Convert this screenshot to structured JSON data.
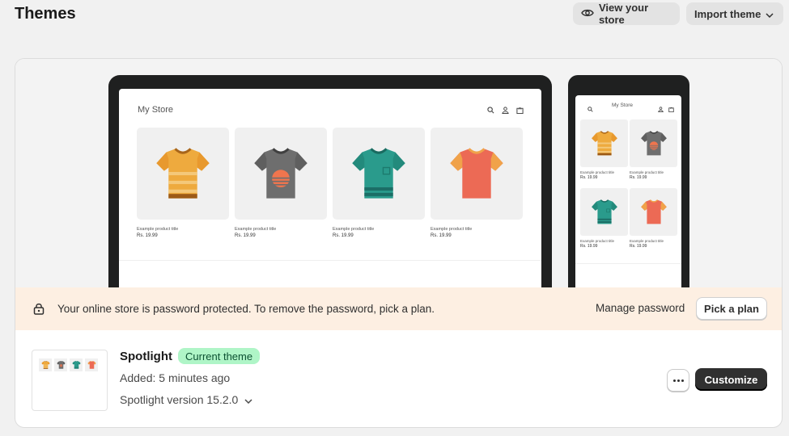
{
  "page": {
    "title": "Themes"
  },
  "header": {
    "view_store_label": "View your store",
    "import_theme_label": "Import theme"
  },
  "preview": {
    "store_name": "My Store",
    "products": [
      {
        "title": "Example product title",
        "price": "Rs. 19.99",
        "shirt": "yellow-striped"
      },
      {
        "title": "Example product title",
        "price": "Rs. 19.99",
        "shirt": "gray-sunset"
      },
      {
        "title": "Example product title",
        "price": "Rs. 19.99",
        "shirt": "teal-pocket"
      },
      {
        "title": "Example product title",
        "price": "Rs. 19.99",
        "shirt": "coral"
      }
    ]
  },
  "banner": {
    "message": "Your online store is password protected. To remove the password, pick a plan.",
    "manage_password_label": "Manage password",
    "pick_plan_label": "Pick a plan"
  },
  "theme": {
    "name": "Spotlight",
    "badge": "Current theme",
    "added": "Added: 5 minutes ago",
    "version": "Spotlight version 15.2.0",
    "customize_label": "Customize"
  },
  "colors": {
    "badge_bg": "#aff5c7",
    "banner_bg": "#fdefe2",
    "primary_button": "#303030"
  }
}
